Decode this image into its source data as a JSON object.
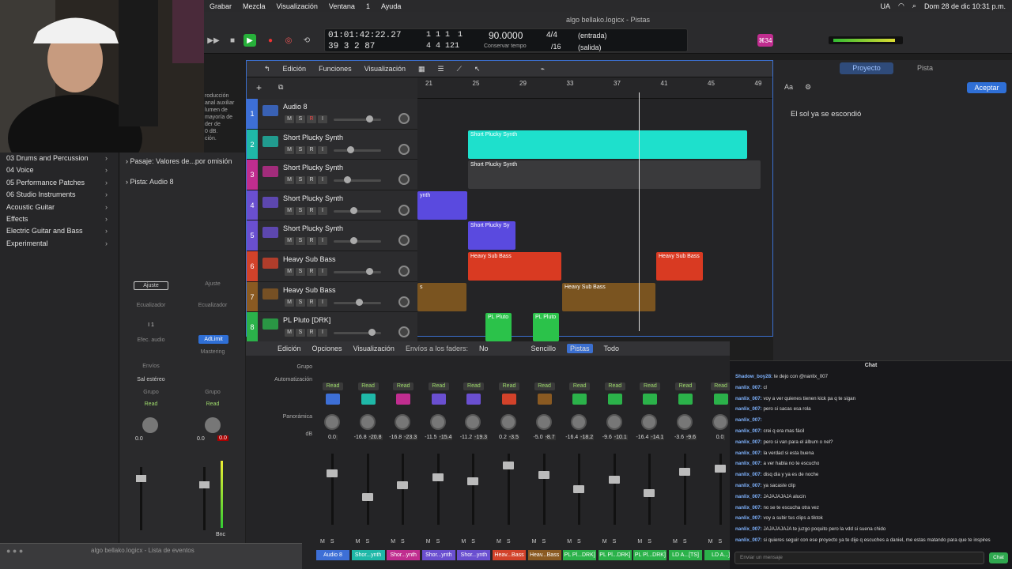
{
  "menubar": {
    "items": [
      "Grabar",
      "Mezcla",
      "Visualización",
      "Ventana",
      "1",
      "Ayuda"
    ],
    "lang": "UA",
    "datetime": "Dom 28 de dic 10:31 p.m."
  },
  "window": {
    "title": "algo bellako.logicx - Pistas",
    "eventlist_title": "algo bellako.logicx - Lista de eventos"
  },
  "lcd": {
    "time": "01:01:42:22.27",
    "bars_top": "1  1  1",
    "bars_top_end": "1",
    "bars_bottom": "39  3  2  87",
    "bars_bottom_end": "4  4  121",
    "tempo": "90.0000",
    "tempo_label": "Conservar tempo",
    "sig": "4/4",
    "div": "/16",
    "input": "(entrada)",
    "output": "(salida)",
    "key_badge": "⌘34"
  },
  "library": {
    "items": [
      "03 Drums and Percussion",
      "04 Voice",
      "05 Performance Patches",
      "06 Studio Instruments",
      "Acoustic Guitar",
      "Effects",
      "Electric Guitar and Bass",
      "Experimental"
    ]
  },
  "inspector": {
    "region_label": "Pasaje:",
    "region_value": "Valores de...por omisión",
    "track_label": "Pista:",
    "track_value": "Audio 8",
    "left": {
      "ajuste": "Ajuste",
      "eq": "Ecualizador",
      "in": "I 1",
      "fx": "Efec. audio",
      "envios": "Envíos",
      "out": "Sal estéreo",
      "grupo": "Grupo",
      "read": "Read",
      "val": "0.0"
    },
    "right": {
      "ajuste": "Ajuste",
      "eq": "Ecualizador",
      "plugin": "AdLimit",
      "mastering": "Mastering",
      "grupo": "Grupo",
      "read": "Read",
      "val": "0.0",
      "val2": "0.0",
      "bnc": "Bnc"
    },
    "partial_text": [
      "roducción",
      "anal auxiliar",
      "lumen de",
      "mayoría de",
      "der de",
      "0 dB.",
      "ción."
    ]
  },
  "tracks_toolbar": {
    "edicion": "Edición",
    "funciones": "Funciones",
    "visualizacion": "Visualización"
  },
  "ruler": [
    "21",
    "25",
    "29",
    "33",
    "37",
    "41",
    "45",
    "49"
  ],
  "tracks": [
    {
      "num": "1",
      "name": "Audio 8",
      "color": "#3d6fd6"
    },
    {
      "num": "2",
      "name": "Short Plucky Synth",
      "color": "#1fb8a8"
    },
    {
      "num": "3",
      "name": "Short Plucky Synth",
      "color": "#c02d8f"
    },
    {
      "num": "4",
      "name": "Short Plucky Synth",
      "color": "#6a4fd0"
    },
    {
      "num": "5",
      "name": "Short Plucky Synth",
      "color": "#6a4fd0"
    },
    {
      "num": "6",
      "name": "Heavy Sub Bass",
      "color": "#d2422a"
    },
    {
      "num": "7",
      "name": "Heavy Sub Bass",
      "color": "#8a5a22"
    },
    {
      "num": "8",
      "name": "PL Pluto [DRK]",
      "color": "#2bb24a"
    }
  ],
  "regions": {
    "r1": "Short Plucky Synth",
    "r2": "Short Plucky Synth",
    "r3": "ynth",
    "r4": "Short Plucky Sy",
    "r5": "Heavy Sub Bass",
    "r6": "Heavy Sub Bass",
    "r7": "s",
    "r8": "Heavy Sub Bass",
    "r9": "PL Pluto",
    "r10": "PL Pluto"
  },
  "msri": {
    "m": "M",
    "s": "S",
    "r": "R",
    "i": "I"
  },
  "right_panel": {
    "tab_proyecto": "Proyecto",
    "tab_pista": "Pista",
    "accept": "Aceptar",
    "aa": "Aa",
    "note": "El sol ya se escondió"
  },
  "mixer_bar": {
    "edicion": "Edición",
    "opciones": "Opciones",
    "visualizacion": "Visualización",
    "envios": "Envíos a los faders:",
    "no": "No",
    "sencillo": "Sencillo",
    "pistas": "Pistas",
    "todo": "Todo",
    "grupo": "Grupo",
    "automatizacion": "Automatización",
    "panoramica": "Panorámica",
    "db": "dB"
  },
  "strips": [
    {
      "name": "Audio 8",
      "db": "0.0",
      "peak": "",
      "color": "#3d6fd6",
      "read": "Read"
    },
    {
      "name": "Shor...ynth",
      "db": "-16.8",
      "peak": "-20.8",
      "color": "#1fb8a8",
      "read": "Read"
    },
    {
      "name": "Shor...ynth",
      "db": "-16.8",
      "peak": "-23.3",
      "color": "#c02d8f",
      "read": "Read"
    },
    {
      "name": "Shor...ynth",
      "db": "-11.5",
      "peak": "-15.4",
      "color": "#6a4fd0",
      "read": "Read"
    },
    {
      "name": "Shor...ynth",
      "db": "-11.2",
      "peak": "-19.3",
      "color": "#6a4fd0",
      "read": "Read"
    },
    {
      "name": "Heav...Bass",
      "db": "0.2",
      "peak": "-3.5",
      "color": "#d2422a",
      "read": "Read"
    },
    {
      "name": "Heav...Bass",
      "db": "-5.0",
      "peak": "-8.7",
      "color": "#8a5a22",
      "read": "Read"
    },
    {
      "name": "PL Pl...DRK]",
      "db": "-16.4",
      "peak": "-18.2",
      "color": "#2bb24a",
      "read": "Read"
    },
    {
      "name": "PL Pl...DRK]",
      "db": "-9.6",
      "peak": "-10.1",
      "color": "#2bb24a",
      "read": "Read"
    },
    {
      "name": "PL Pl...DRK]",
      "db": "-16.4",
      "peak": "-14.1",
      "color": "#2bb24a",
      "read": "Read"
    },
    {
      "name": "LD A...[TS]",
      "db": "-3.6",
      "peak": "-9.6",
      "color": "#2bb24a",
      "read": "Read"
    },
    {
      "name": "LD A...]",
      "db": "0.0",
      "peak": "",
      "color": "#2bb24a",
      "read": "Read"
    }
  ],
  "chat": {
    "title": "Chat",
    "placeholder": "Enviar un mensaje",
    "button": "Chat",
    "messages": [
      {
        "user": "Shadow_boy28:",
        "text": " te dejo con @nanlix_007"
      },
      {
        "user": "nanlix_007:",
        "text": " cl"
      },
      {
        "user": "nanlix_007:",
        "text": " voy a ver quienes tienen kick pa q te sigan"
      },
      {
        "user": "nanlix_007:",
        "text": " pero si sacas esa rola"
      },
      {
        "user": "nanlix_007:",
        "text": " "
      },
      {
        "user": "nanlix_007:",
        "text": " crei q era mas fácil"
      },
      {
        "user": "nanlix_007:",
        "text": " pero si van para el álbum o nel?"
      },
      {
        "user": "nanlix_007:",
        "text": " la verdad si esta buena"
      },
      {
        "user": "nanlix_007:",
        "text": " a ver habla no te escucho"
      },
      {
        "user": "nanlix_007:",
        "text": " disq dia y ya es de noche"
      },
      {
        "user": "nanlix_007:",
        "text": " ya sacaste clip"
      },
      {
        "user": "nanlix_007:",
        "text": " JAJAJAJAJA alucin"
      },
      {
        "user": "nanlix_007:",
        "text": " no se te escucha otra vez"
      },
      {
        "user": "nanlix_007:",
        "text": " voy a subir tus clips a tiktok"
      },
      {
        "user": "nanlix_007:",
        "text": " JAJAJAJAJA te juzgo poquito pero la vdd si suena chido"
      },
      {
        "user": "nanlix_007:",
        "text": " si quieres seguir con ese proyecto ya te dije q escuches a daniel, me estas matando para que te inspires"
      }
    ]
  }
}
